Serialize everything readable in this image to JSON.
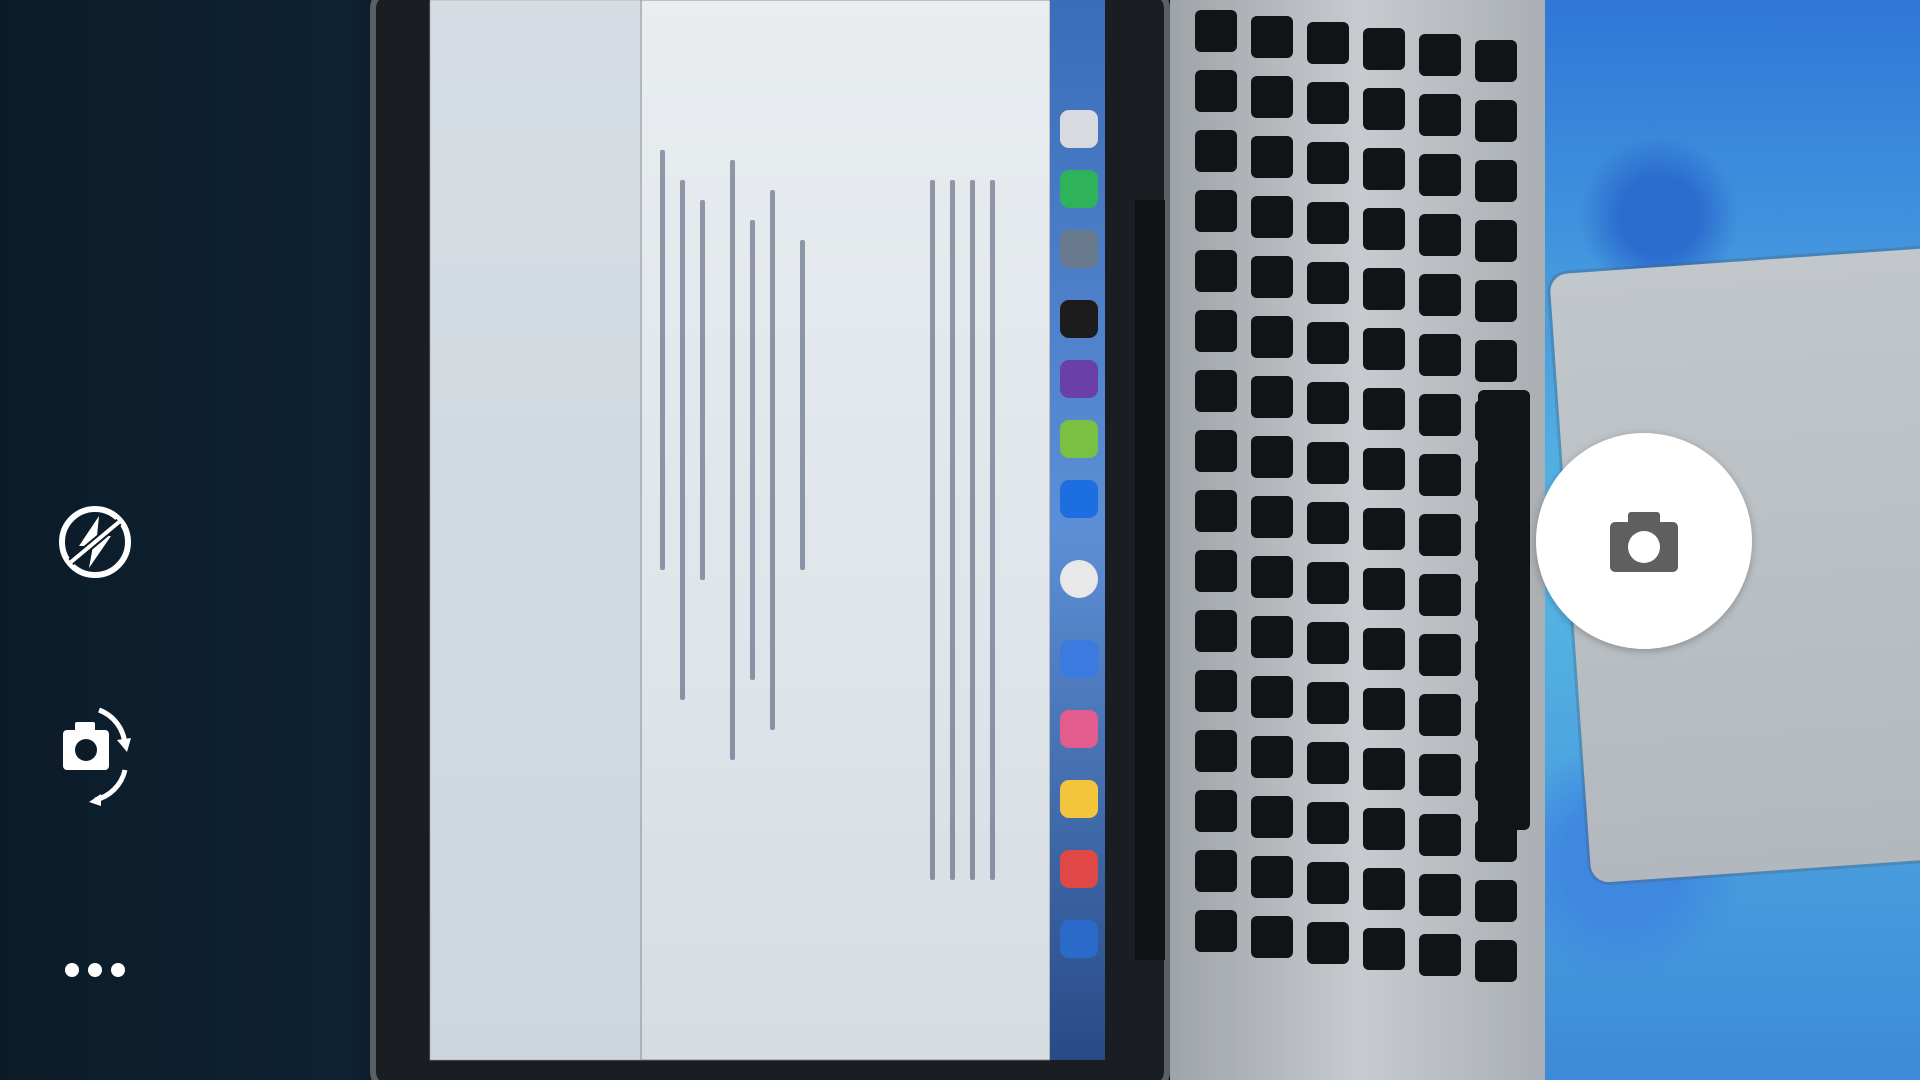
{
  "app": {
    "name": "Camera"
  },
  "controls": {
    "flash": {
      "icon": "flash-auto-icon"
    },
    "switch_camera": {
      "icon": "switch-camera-icon"
    },
    "more": {
      "icon": "more-horizontal-icon"
    },
    "shutter": {
      "icon": "camera-icon"
    }
  },
  "colors": {
    "control_icon": "#ffffff",
    "shutter_bg": "#ffffff",
    "shutter_icon": "#5f5f5f"
  }
}
